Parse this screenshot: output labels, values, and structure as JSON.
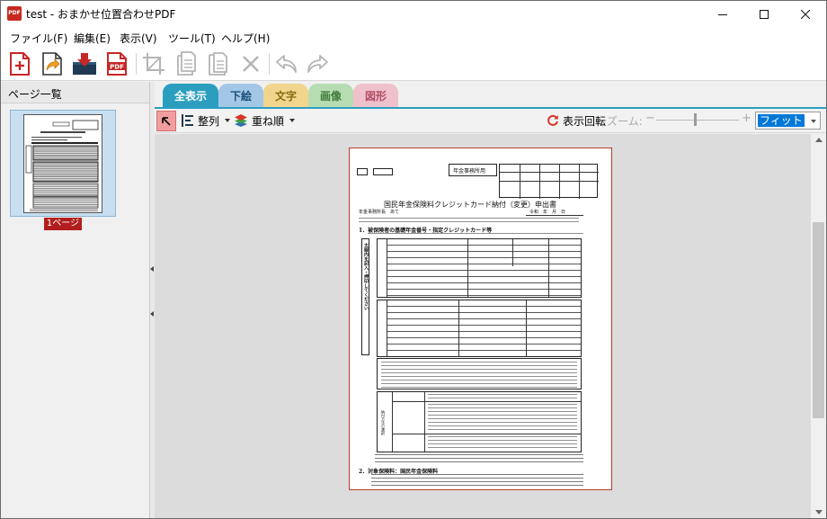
{
  "window": {
    "title": "test - おまかせ位置合わせPDF",
    "icon_text": "PDF"
  },
  "menu": {
    "items": [
      "ファイル(F)",
      "編集(E)",
      "表示(V)",
      "ツール(T)",
      "ヘルプ(H)"
    ]
  },
  "toolbar": {
    "icons": [
      "new-file-icon",
      "open-file-icon",
      "import-icon",
      "pdf-export-icon",
      "crop-icon",
      "copy-page-icon",
      "paste-page-icon",
      "delete-icon",
      "undo-icon",
      "redo-icon"
    ]
  },
  "page_panel": {
    "title": "ページ一覧",
    "pages": [
      {
        "label": "1ページ"
      }
    ]
  },
  "tabs": [
    {
      "label": "全表示",
      "active": true,
      "color": "#2b9ec0"
    },
    {
      "label": "下絵",
      "color": "#a3c7e6"
    },
    {
      "label": "文字",
      "color": "#f1d58c"
    },
    {
      "label": "画像",
      "color": "#b6dcb2"
    },
    {
      "label": "図形",
      "color": "#efc1cc"
    }
  ],
  "viewbar": {
    "align_label": "整列",
    "order_label": "重ね順",
    "rotate_label": "表示回転",
    "zoom_label": "ズーム:",
    "zoom_minus": "−",
    "zoom_plus": "+",
    "zoom_value": "フィット"
  },
  "document": {
    "office_label": "年金事務所用",
    "title": "国民年金保険料クレジットカード納付（変更）申出書",
    "date_label": "令和　年　月　日",
    "addressee": "年金事務所長　あて",
    "section1": "1．被保険者の基礎年金番号・指定クレジットカード等",
    "side_note": "太線内を記入・押印してください",
    "section2": "2．対象保険料：国民年金保険料",
    "payment_label": "納付方法の選択"
  },
  "colors": {
    "accent": "#2b9ec0",
    "selection": "#0078d7",
    "page_border": "#c0392b",
    "thumb_label": "#b21e1e"
  }
}
